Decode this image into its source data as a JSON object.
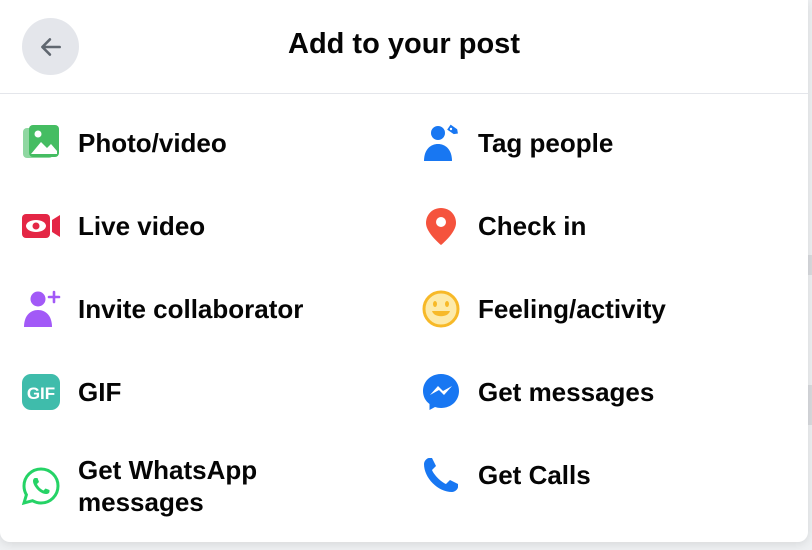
{
  "dialog": {
    "title": "Add to your post",
    "back_label": "Back"
  },
  "options": [
    {
      "id": "photo-video",
      "label": "Photo/video",
      "icon": "photo-video-icon",
      "color": "#45bd62"
    },
    {
      "id": "tag-people",
      "label": "Tag people",
      "icon": "tag-people-icon",
      "color": "#1877f2"
    },
    {
      "id": "live-video",
      "label": "Live video",
      "icon": "live-video-icon",
      "color": "#e42645"
    },
    {
      "id": "check-in",
      "label": "Check in",
      "icon": "location-pin-icon",
      "color": "#f5533d"
    },
    {
      "id": "invite-collaborator",
      "label": "Invite collaborator",
      "icon": "invite-collaborator-icon",
      "color": "#a259f7"
    },
    {
      "id": "feeling-activity",
      "label": "Feeling/activity",
      "icon": "smiley-icon",
      "color": "#f7b928"
    },
    {
      "id": "gif",
      "label": "GIF",
      "icon": "gif-icon",
      "color": "#3fbcab"
    },
    {
      "id": "get-messages",
      "label": "Get messages",
      "icon": "messenger-icon",
      "color": "#1877f2"
    },
    {
      "id": "get-whatsapp-messages",
      "label": "Get WhatsApp\nmessages",
      "icon": "whatsapp-icon",
      "color": "#25d366"
    },
    {
      "id": "get-calls",
      "label": "Get Calls",
      "icon": "phone-icon",
      "color": "#1877f2"
    }
  ]
}
